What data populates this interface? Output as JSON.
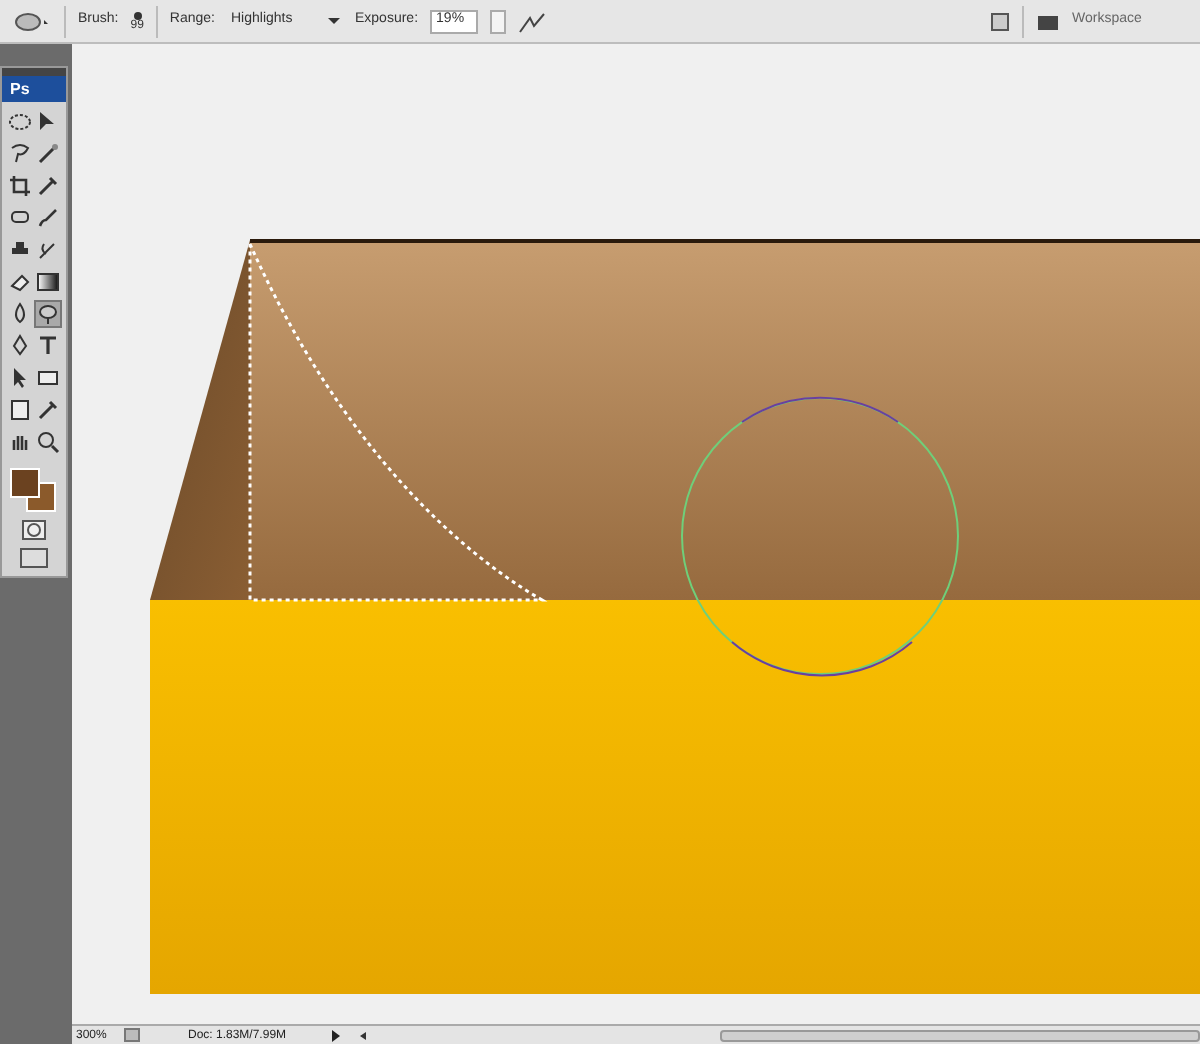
{
  "options_bar": {
    "brush_label": "Brush:",
    "brush_size": "99",
    "range_label": "Range:",
    "range_value": "Highlights",
    "exposure_label": "Exposure:",
    "exposure_value": "19%",
    "workspace": "Workspace"
  },
  "tools_panel": {
    "logo": "Ps",
    "tools": [
      {
        "kind": "ellipse",
        "selected": false
      },
      {
        "kind": "move",
        "selected": false
      },
      {
        "kind": "lasso",
        "selected": false
      },
      {
        "kind": "wand",
        "selected": false
      },
      {
        "kind": "crop",
        "selected": false
      },
      {
        "kind": "eyedropper",
        "selected": false
      },
      {
        "kind": "heal",
        "selected": false
      },
      {
        "kind": "brush",
        "selected": false
      },
      {
        "kind": "stamp",
        "selected": false
      },
      {
        "kind": "history",
        "selected": false
      },
      {
        "kind": "eraser",
        "selected": false
      },
      {
        "kind": "gradient",
        "selected": false
      },
      {
        "kind": "blur",
        "selected": false
      },
      {
        "kind": "dodge",
        "selected": true
      },
      {
        "kind": "pen",
        "selected": false
      },
      {
        "kind": "type",
        "selected": false
      },
      {
        "kind": "arrow",
        "selected": false
      },
      {
        "kind": "rectangle",
        "selected": false
      },
      {
        "kind": "notes",
        "selected": false
      },
      {
        "kind": "eyedropper",
        "selected": false
      },
      {
        "kind": "hand",
        "selected": false
      },
      {
        "kind": "zoom",
        "selected": false
      }
    ]
  },
  "status_bar": {
    "zoom": "300%",
    "doc": "Doc: 1.83M/7.99M"
  }
}
